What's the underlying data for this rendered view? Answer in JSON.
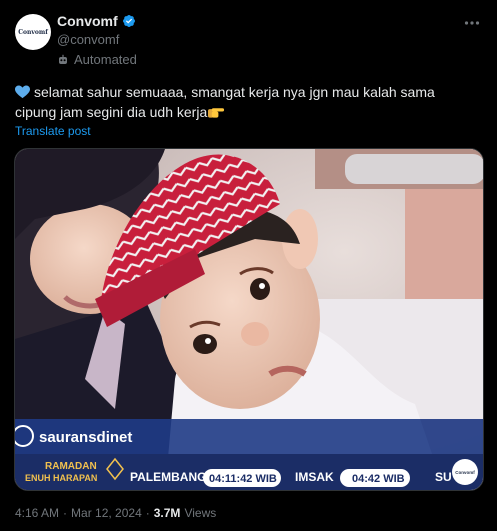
{
  "author": {
    "display_name": "Convomf",
    "handle": "@convomf",
    "automated_label": "Automated",
    "avatar_text": "Convomf"
  },
  "tweet": {
    "text": "selamat sahur semuaaa, smangat kerja nya jgn mau kalah sama cipung jam segini dia udh kerja",
    "translate_label": "Translate post"
  },
  "meta": {
    "time": "4:16 AM",
    "date": "Mar 12, 2024",
    "separator": "·",
    "views_count": "3.7M",
    "views_label": "Views"
  },
  "media_overlay": {
    "watermark_handle": "sauransdinet",
    "ramadan_line1": "RAMADAN",
    "ramadan_line2": "ENUH HARAPAN",
    "city": "PALEMBANG",
    "city_time": "04:11:42 WIB",
    "imsak_label": "IMSAK",
    "imsak_time": "04:42 WIB",
    "next_city_partial": "SU",
    "corner_logo": "Convomf"
  },
  "icons": {
    "verified": "verified-badge-icon",
    "more": "more-options-icon",
    "automated": "bot-icon",
    "heart_emoji": "blue-heart",
    "hand_emoji": "pointing-hand"
  },
  "colors": {
    "background": "#000000",
    "text": "#e7e9ea",
    "secondary": "#71767b",
    "link": "#1d9bf0",
    "verified": "#1d9bf0"
  }
}
